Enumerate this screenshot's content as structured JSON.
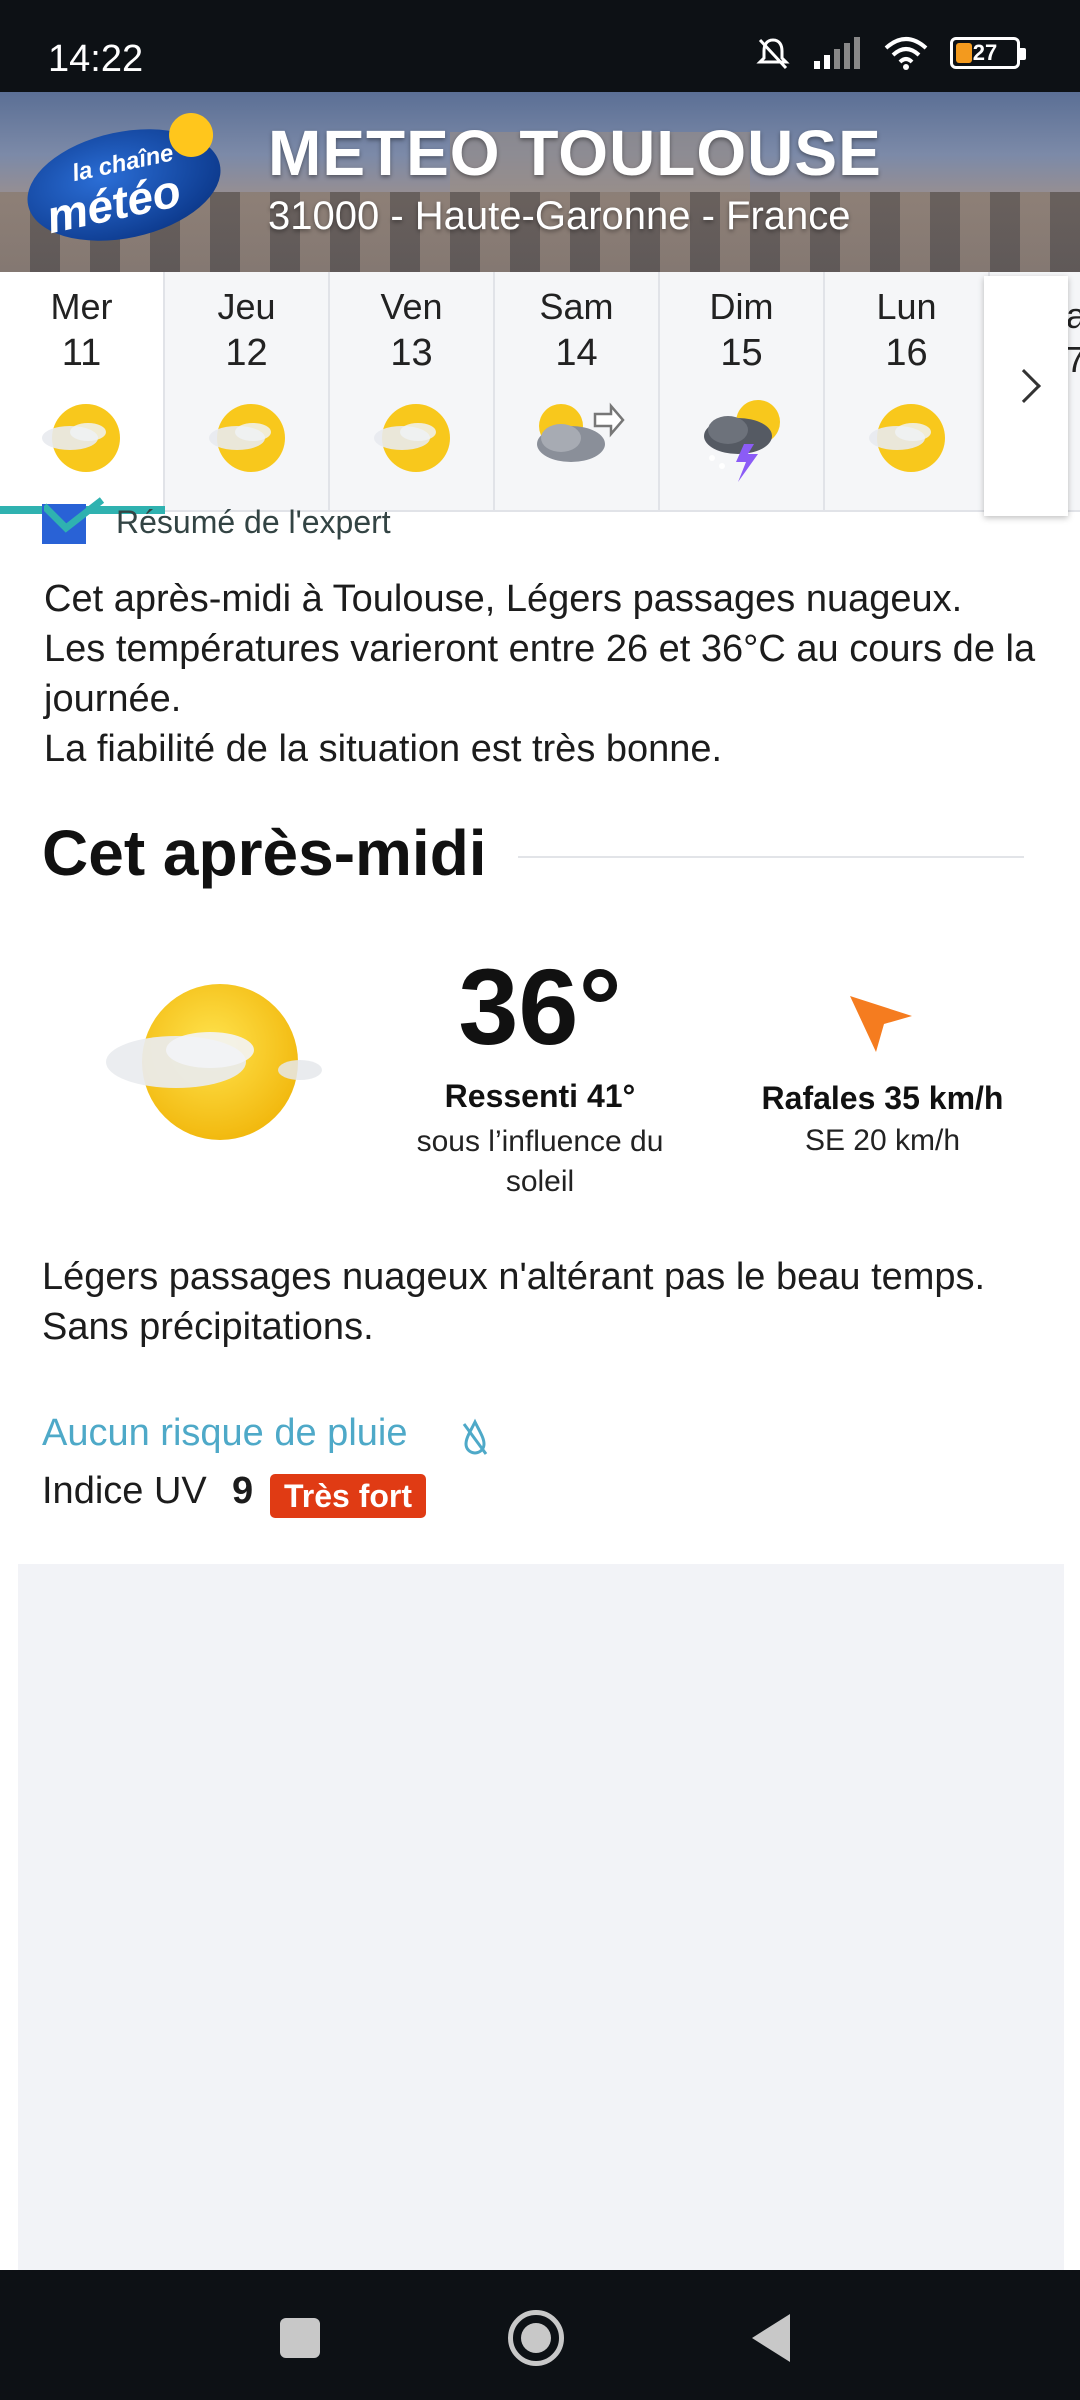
{
  "status_bar": {
    "time": "14:22",
    "battery": "27",
    "icons": [
      "mute-icon",
      "signal-icon",
      "wifi-icon",
      "battery-icon"
    ]
  },
  "header": {
    "logo_line1": "la chaîne",
    "logo_line2": "météo",
    "title": "METEO TOULOUSE",
    "subtitle": "31000 - Haute-Garonne - France"
  },
  "days": [
    {
      "name": "Mer",
      "num": "11",
      "icon": "sun-partly-cloudy-icon",
      "active": true
    },
    {
      "name": "Jeu",
      "num": "12",
      "icon": "sun-partly-cloudy-icon"
    },
    {
      "name": "Ven",
      "num": "13",
      "icon": "sun-partly-cloudy-icon"
    },
    {
      "name": "Sam",
      "num": "14",
      "icon": "cloud-wind-icon"
    },
    {
      "name": "Dim",
      "num": "15",
      "icon": "thunderstorm-icon"
    },
    {
      "name": "Lun",
      "num": "16",
      "icon": "sun-partly-cloudy-icon"
    }
  ],
  "days_peek": "a\n7",
  "expert": {
    "label": "Résumé de l'expert"
  },
  "summary": [
    "Cet après-midi à Toulouse, Légers passages nuageux.",
    "Les températures varieront entre 26 et 36°C au cours de la journée.",
    "La fiabilité de la situation est très bonne."
  ],
  "afternoon": {
    "title": "Cet après-midi",
    "temperature": "36°",
    "feels_like": "Ressenti 41°",
    "feels_note": "sous l’influence du soleil",
    "gusts": "Rafales 35 km/h",
    "wind": "SE 20 km/h",
    "description": [
      "Légers passages nuageux n'altérant pas le beau temps.",
      "Sans précipitations."
    ],
    "rain": "Aucun risque de pluie",
    "uv_label": "Indice UV",
    "uv_value": "9",
    "uv_badge": "Très fort"
  },
  "colors": {
    "accent_teal": "#2fb2b0",
    "rain_blue": "#4ea9c8",
    "uv_red": "#e03b14",
    "wind_orange": "#f57c1f"
  }
}
